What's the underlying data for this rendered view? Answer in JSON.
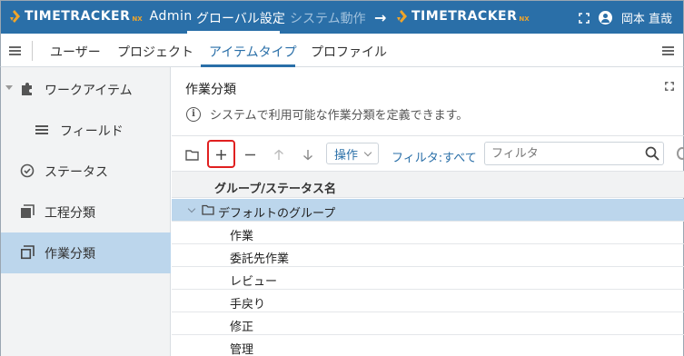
{
  "app": {
    "logo_text": "TIMETRACKER",
    "logo_suffix": "NX",
    "logo_admin": "Admin",
    "logo2_text": "TIMETRACKER",
    "logo2_suffix": "NX",
    "arrow": "→",
    "user_name": "岡本 直哉",
    "brand_color": "#2a6fa8",
    "accent_color": "#f0a52a"
  },
  "top_tabs": [
    {
      "label": "グローバル設定",
      "active": true
    },
    {
      "label": "システム動作",
      "active": false
    }
  ],
  "sub_tabs": [
    {
      "label": "ユーザー"
    },
    {
      "label": "プロジェクト"
    },
    {
      "label": "アイテムタイプ",
      "active": true
    },
    {
      "label": "プロファイル"
    }
  ],
  "sidebar": {
    "items": [
      {
        "label": "ワークアイテム",
        "icon": "puzzle-icon"
      },
      {
        "label": "フィールド",
        "icon": "list-icon"
      },
      {
        "label": "ステータス",
        "icon": "check-circle-icon"
      },
      {
        "label": "工程分類",
        "icon": "stack-icon"
      },
      {
        "label": "作業分類",
        "icon": "stack-icon",
        "active": true
      }
    ]
  },
  "main": {
    "title": "作業分類",
    "description": "システムで利用可能な作業分類を定義できます。",
    "info_glyph": "i",
    "toolbar": {
      "operation_label": "操作",
      "filter_link": "フィルタ:すべて",
      "filter_placeholder": "フィルタ"
    },
    "grid": {
      "column_header": "グループ/ステータス名",
      "group_label": "デフォルトのグループ",
      "rows": [
        "作業",
        "委託先作業",
        "レビュー",
        "手戻り",
        "修正",
        "管理"
      ]
    }
  }
}
